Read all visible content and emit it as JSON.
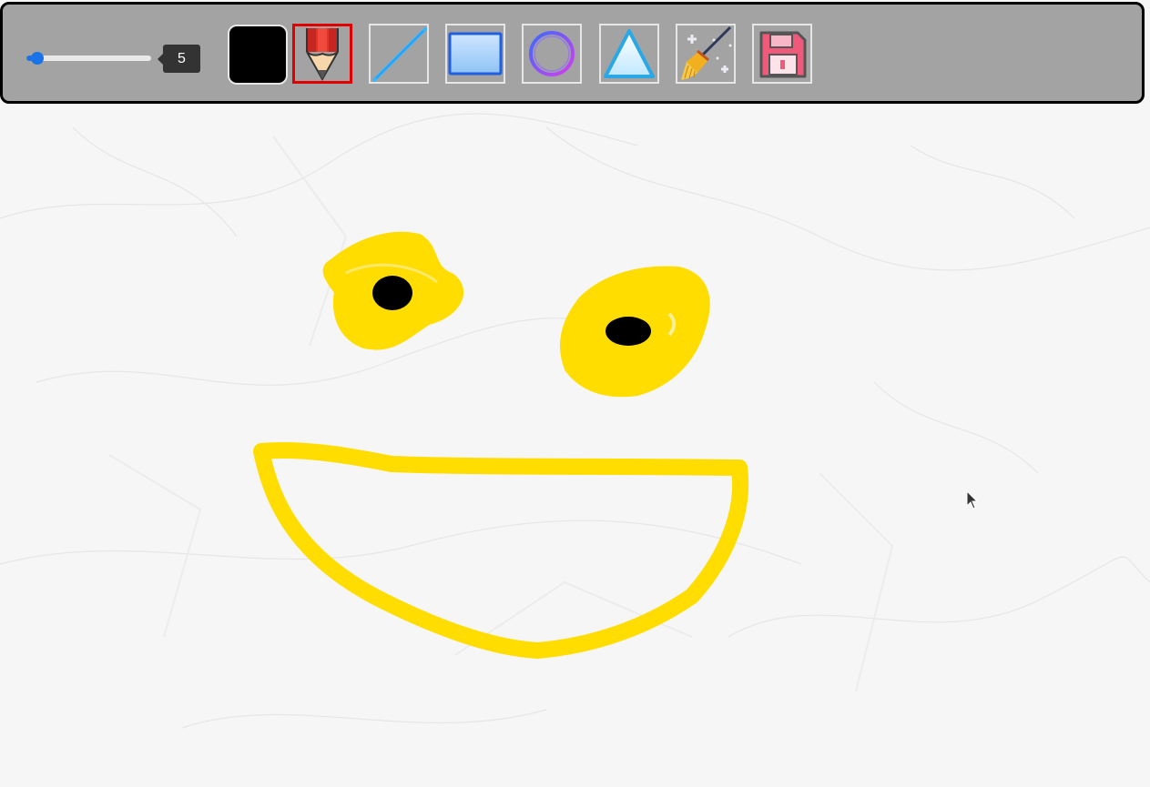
{
  "toolbar": {
    "brush_size": "5",
    "brush_size_fraction": 0.05,
    "current_color": "#000000",
    "tools": [
      {
        "name": "pencil",
        "icon": "pencil-icon",
        "active": true
      },
      {
        "name": "line",
        "icon": "line-icon",
        "active": false
      },
      {
        "name": "rectangle",
        "icon": "rectangle-icon",
        "active": false
      },
      {
        "name": "circle",
        "icon": "circle-icon",
        "active": false
      },
      {
        "name": "triangle",
        "icon": "triangle-icon",
        "active": false
      },
      {
        "name": "clear",
        "icon": "broom-icon",
        "active": false
      },
      {
        "name": "save",
        "icon": "floppy-disk-icon",
        "active": false
      }
    ]
  },
  "canvas": {
    "stroke_colors": {
      "yellow": "#ffdd00",
      "black": "#000000"
    },
    "background": "crumpled-paper"
  },
  "colors": {
    "toolbar_bg": "#a3a3a3",
    "accent": "#1a73e8",
    "active_border": "#e00000"
  }
}
